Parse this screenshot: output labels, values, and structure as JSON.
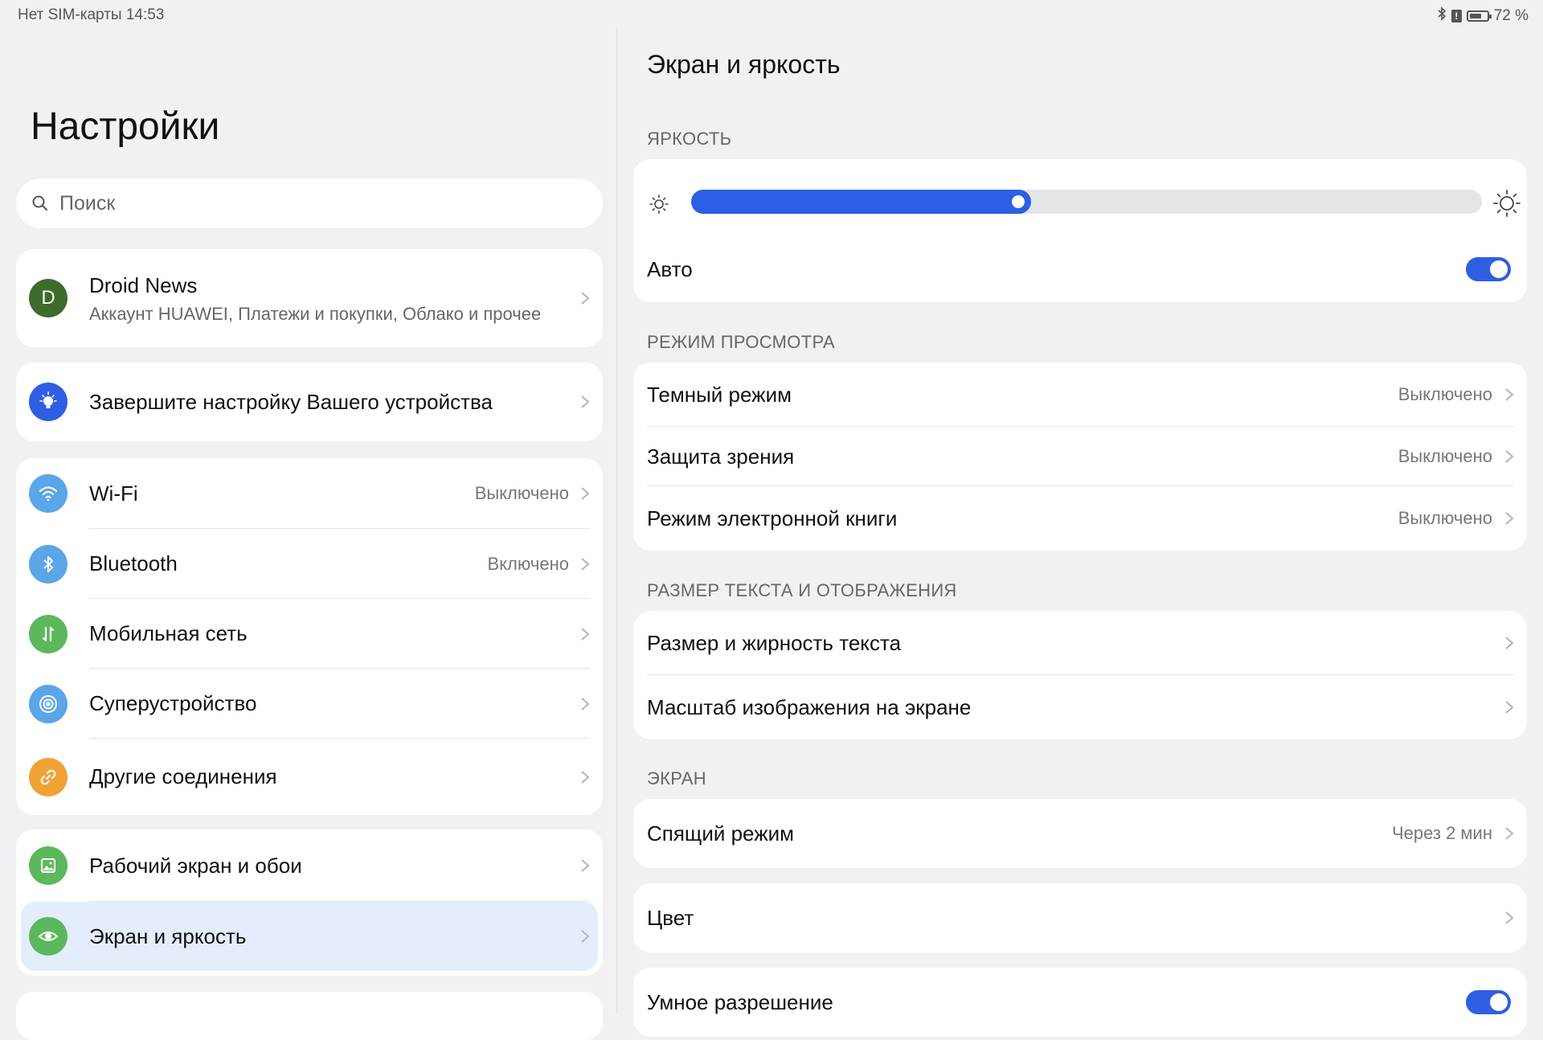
{
  "status_bar": {
    "left": "Нет SIM-карты 14:53",
    "battery": "72 %",
    "battery_level": 0.72
  },
  "left": {
    "title": "Настройки",
    "search_placeholder": "Поиск",
    "profile": {
      "initial": "D",
      "name": "Droid News",
      "subtitle": "Аккаунт HUAWEI, Платежи и покупки, Облако и прочее"
    },
    "setup": {
      "label": "Завершите настройку Вашего устройства"
    },
    "connections": [
      {
        "label": "Wi-Fi",
        "value": "Выключено",
        "icon": "wifi-icon",
        "color": "#5aa6e6"
      },
      {
        "label": "Bluetooth",
        "value": "Включено",
        "icon": "bluetooth-icon",
        "color": "#5aa6e6"
      },
      {
        "label": "Мобильная сеть",
        "value": "",
        "icon": "mobile-data-icon",
        "color": "#5cb85c"
      },
      {
        "label": "Суперустройство",
        "value": "",
        "icon": "super-device-icon",
        "color": "#5aa6e6"
      },
      {
        "label": "Другие соединения",
        "value": "",
        "icon": "link-icon",
        "color": "#f0a235"
      }
    ],
    "display_group": [
      {
        "label": "Рабочий экран и обои",
        "icon": "wallpaper-icon",
        "color": "#5cb85c"
      },
      {
        "label": "Экран и яркость",
        "icon": "eye-icon",
        "color": "#5cb85c",
        "selected": true
      }
    ]
  },
  "right": {
    "title": "Экран и яркость",
    "brightness_section": "ЯРКОСТЬ",
    "brightness_level": 0.43,
    "auto_label": "Авто",
    "auto_on": true,
    "view_section": "РЕЖИМ ПРОСМОТРА",
    "view_rows": [
      {
        "label": "Темный режим",
        "value": "Выключено"
      },
      {
        "label": "Защита зрения",
        "value": "Выключено"
      },
      {
        "label": "Режим электронной книги",
        "value": "Выключено"
      }
    ],
    "text_section": "РАЗМЕР ТЕКСТА И ОТОБРАЖЕНИЯ",
    "text_rows": [
      {
        "label": "Размер и жирность текста"
      },
      {
        "label": "Масштаб изображения на экране"
      }
    ],
    "screen_section": "ЭКРАН",
    "sleep": {
      "label": "Спящий режим",
      "value": "Через 2 мин"
    },
    "color": {
      "label": "Цвет"
    },
    "smart_res": {
      "label": "Умное разрешение",
      "on": true
    }
  }
}
